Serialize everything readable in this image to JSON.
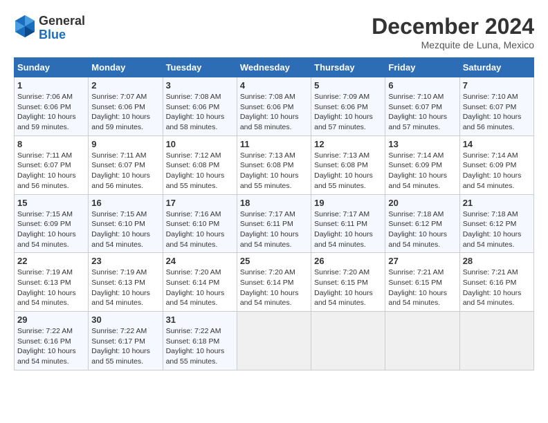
{
  "header": {
    "logo_general": "General",
    "logo_blue": "Blue",
    "month_title": "December 2024",
    "location": "Mezquite de Luna, Mexico"
  },
  "calendar": {
    "headers": [
      "Sunday",
      "Monday",
      "Tuesday",
      "Wednesday",
      "Thursday",
      "Friday",
      "Saturday"
    ],
    "weeks": [
      [
        {
          "day": "1",
          "sunrise": "7:06 AM",
          "sunset": "6:06 PM",
          "daylight": "10 hours and 59 minutes."
        },
        {
          "day": "2",
          "sunrise": "7:07 AM",
          "sunset": "6:06 PM",
          "daylight": "10 hours and 59 minutes."
        },
        {
          "day": "3",
          "sunrise": "7:08 AM",
          "sunset": "6:06 PM",
          "daylight": "10 hours and 58 minutes."
        },
        {
          "day": "4",
          "sunrise": "7:08 AM",
          "sunset": "6:06 PM",
          "daylight": "10 hours and 58 minutes."
        },
        {
          "day": "5",
          "sunrise": "7:09 AM",
          "sunset": "6:06 PM",
          "daylight": "10 hours and 57 minutes."
        },
        {
          "day": "6",
          "sunrise": "7:10 AM",
          "sunset": "6:07 PM",
          "daylight": "10 hours and 57 minutes."
        },
        {
          "day": "7",
          "sunrise": "7:10 AM",
          "sunset": "6:07 PM",
          "daylight": "10 hours and 56 minutes."
        }
      ],
      [
        {
          "day": "8",
          "sunrise": "7:11 AM",
          "sunset": "6:07 PM",
          "daylight": "10 hours and 56 minutes."
        },
        {
          "day": "9",
          "sunrise": "7:11 AM",
          "sunset": "6:07 PM",
          "daylight": "10 hours and 56 minutes."
        },
        {
          "day": "10",
          "sunrise": "7:12 AM",
          "sunset": "6:08 PM",
          "daylight": "10 hours and 55 minutes."
        },
        {
          "day": "11",
          "sunrise": "7:13 AM",
          "sunset": "6:08 PM",
          "daylight": "10 hours and 55 minutes."
        },
        {
          "day": "12",
          "sunrise": "7:13 AM",
          "sunset": "6:08 PM",
          "daylight": "10 hours and 55 minutes."
        },
        {
          "day": "13",
          "sunrise": "7:14 AM",
          "sunset": "6:09 PM",
          "daylight": "10 hours and 54 minutes."
        },
        {
          "day": "14",
          "sunrise": "7:14 AM",
          "sunset": "6:09 PM",
          "daylight": "10 hours and 54 minutes."
        }
      ],
      [
        {
          "day": "15",
          "sunrise": "7:15 AM",
          "sunset": "6:09 PM",
          "daylight": "10 hours and 54 minutes."
        },
        {
          "day": "16",
          "sunrise": "7:15 AM",
          "sunset": "6:10 PM",
          "daylight": "10 hours and 54 minutes."
        },
        {
          "day": "17",
          "sunrise": "7:16 AM",
          "sunset": "6:10 PM",
          "daylight": "10 hours and 54 minutes."
        },
        {
          "day": "18",
          "sunrise": "7:17 AM",
          "sunset": "6:11 PM",
          "daylight": "10 hours and 54 minutes."
        },
        {
          "day": "19",
          "sunrise": "7:17 AM",
          "sunset": "6:11 PM",
          "daylight": "10 hours and 54 minutes."
        },
        {
          "day": "20",
          "sunrise": "7:18 AM",
          "sunset": "6:12 PM",
          "daylight": "10 hours and 54 minutes."
        },
        {
          "day": "21",
          "sunrise": "7:18 AM",
          "sunset": "6:12 PM",
          "daylight": "10 hours and 54 minutes."
        }
      ],
      [
        {
          "day": "22",
          "sunrise": "7:19 AM",
          "sunset": "6:13 PM",
          "daylight": "10 hours and 54 minutes."
        },
        {
          "day": "23",
          "sunrise": "7:19 AM",
          "sunset": "6:13 PM",
          "daylight": "10 hours and 54 minutes."
        },
        {
          "day": "24",
          "sunrise": "7:20 AM",
          "sunset": "6:14 PM",
          "daylight": "10 hours and 54 minutes."
        },
        {
          "day": "25",
          "sunrise": "7:20 AM",
          "sunset": "6:14 PM",
          "daylight": "10 hours and 54 minutes."
        },
        {
          "day": "26",
          "sunrise": "7:20 AM",
          "sunset": "6:15 PM",
          "daylight": "10 hours and 54 minutes."
        },
        {
          "day": "27",
          "sunrise": "7:21 AM",
          "sunset": "6:15 PM",
          "daylight": "10 hours and 54 minutes."
        },
        {
          "day": "28",
          "sunrise": "7:21 AM",
          "sunset": "6:16 PM",
          "daylight": "10 hours and 54 minutes."
        }
      ],
      [
        {
          "day": "29",
          "sunrise": "7:22 AM",
          "sunset": "6:16 PM",
          "daylight": "10 hours and 54 minutes."
        },
        {
          "day": "30",
          "sunrise": "7:22 AM",
          "sunset": "6:17 PM",
          "daylight": "10 hours and 55 minutes."
        },
        {
          "day": "31",
          "sunrise": "7:22 AM",
          "sunset": "6:18 PM",
          "daylight": "10 hours and 55 minutes."
        },
        null,
        null,
        null,
        null
      ]
    ]
  }
}
